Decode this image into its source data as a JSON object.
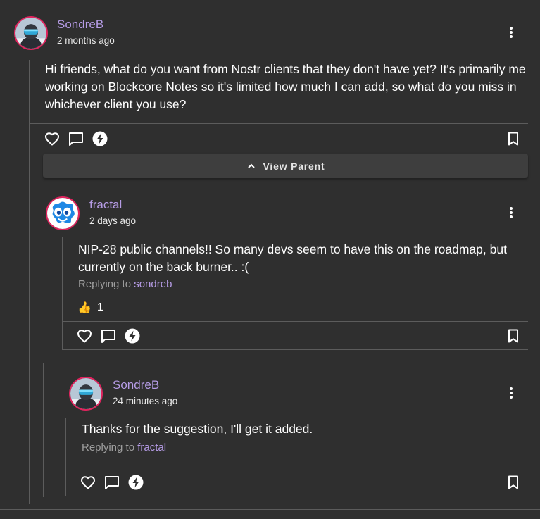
{
  "colors": {
    "background": "#2f2f2f",
    "accent": "#b69ce6",
    "avatar_border": "#e0245e",
    "divider": "#5c5c5c"
  },
  "posts": [
    {
      "author": "SondreB",
      "time": "2 months ago",
      "text": "Hi friends, what do you want from Nostr clients that they don't have yet? It's primarily me working on Blockcore Notes so it's limited how much I can add, so what do you miss in whichever client you use?"
    },
    {
      "author": "fractal",
      "time": "2 days ago",
      "text": "NIP-28 public channels!! So many devs seem to have this on the roadmap, but currently on the back burner.. :(",
      "replying_prefix": "Replying to",
      "replying_to": "sondreb",
      "reaction_emoji": "👍",
      "reaction_count": "1"
    },
    {
      "author": "SondreB",
      "time": "24 minutes ago",
      "text": "Thanks for the suggestion, I'll get it added.",
      "replying_prefix": "Replying to",
      "replying_to": "fractal"
    }
  ],
  "view_parent_label": "View Parent",
  "icons": [
    "heart-icon",
    "comment-icon",
    "zap-icon",
    "bookmark-icon",
    "more-vert-icon",
    "chevron-up-icon"
  ]
}
